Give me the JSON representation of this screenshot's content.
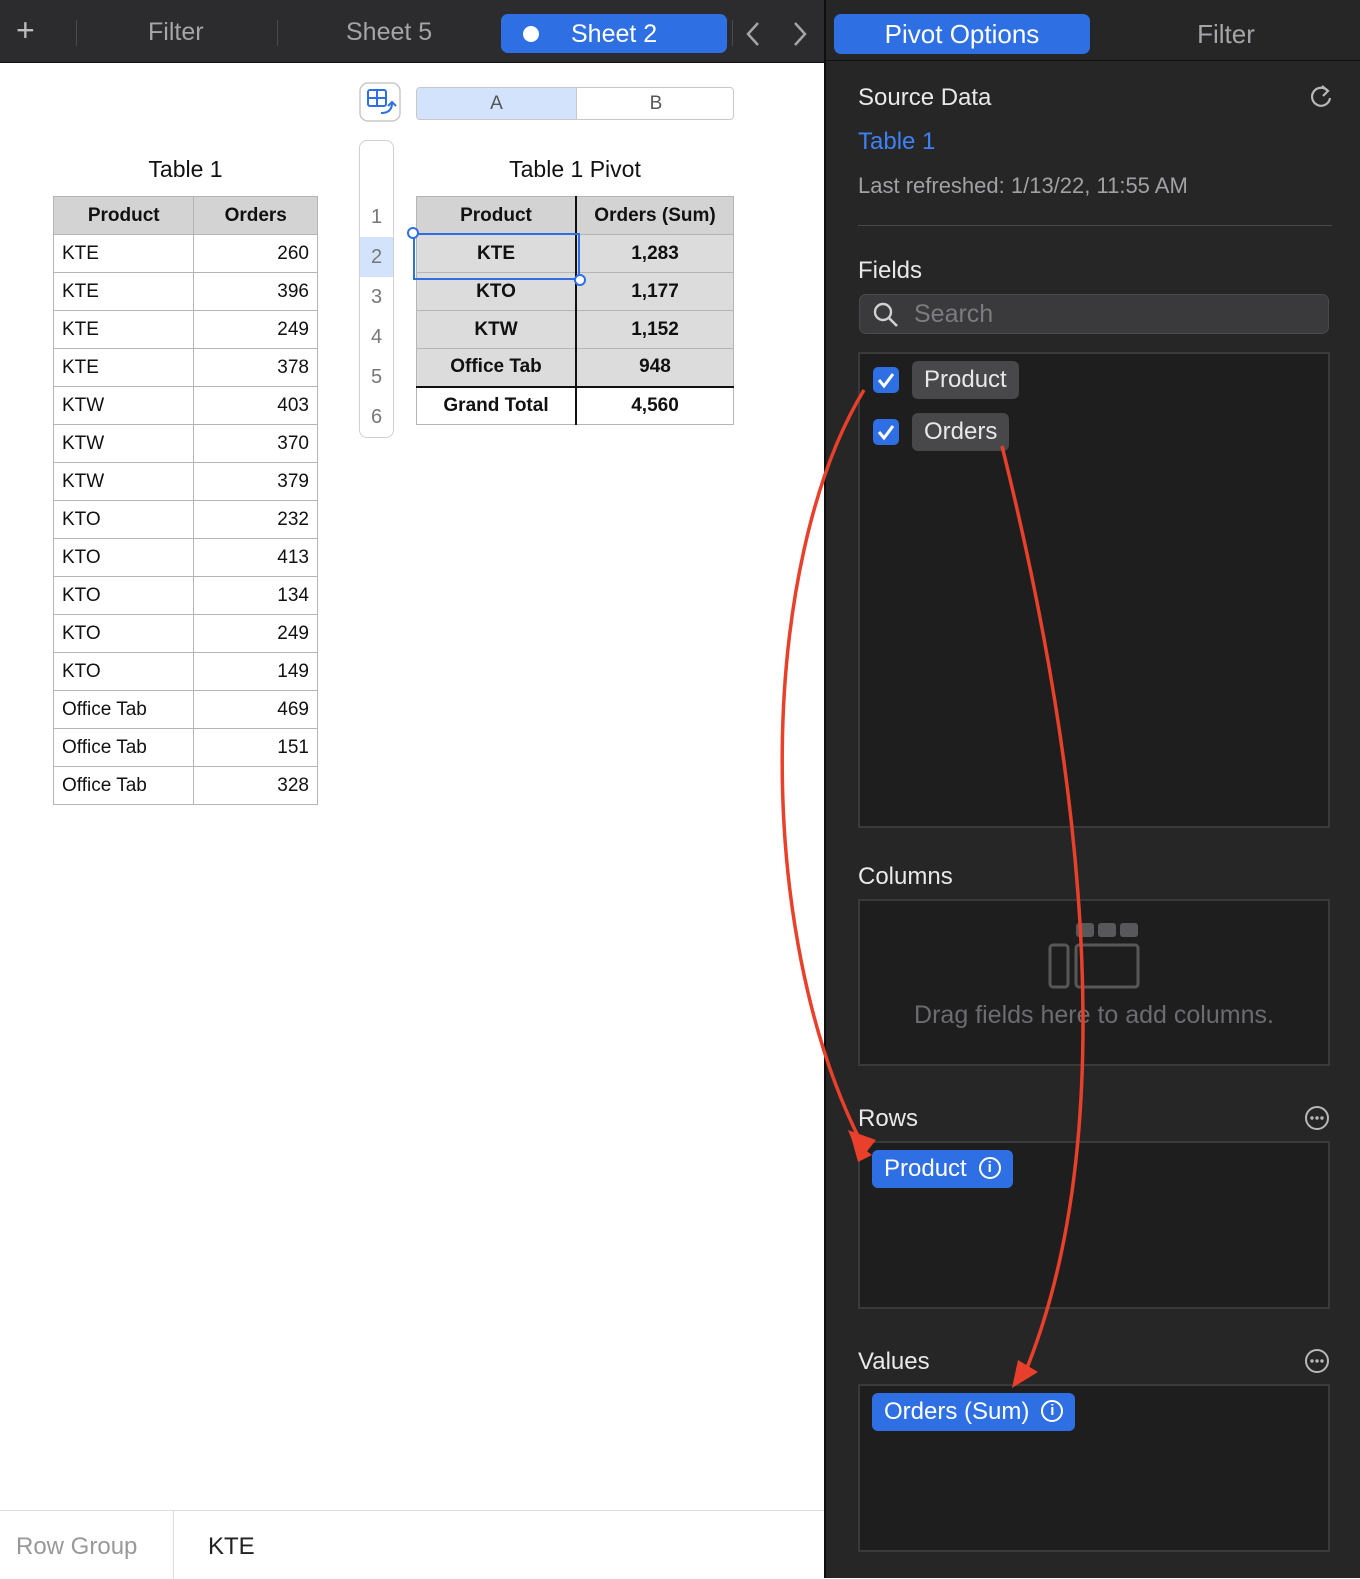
{
  "topbar": {
    "add_label": "+",
    "tabs": [
      "Filter",
      "Sheet 5",
      "Sheet 2"
    ],
    "active_tab": "Sheet 2"
  },
  "sheet": {
    "source_table": {
      "title": "Table 1",
      "headers": [
        "Product",
        "Orders"
      ],
      "rows": [
        [
          "KTE",
          "260"
        ],
        [
          "KTE",
          "396"
        ],
        [
          "KTE",
          "249"
        ],
        [
          "KTE",
          "378"
        ],
        [
          "KTW",
          "403"
        ],
        [
          "KTW",
          "370"
        ],
        [
          "KTW",
          "379"
        ],
        [
          "KTO",
          "232"
        ],
        [
          "KTO",
          "413"
        ],
        [
          "KTO",
          "134"
        ],
        [
          "KTO",
          "249"
        ],
        [
          "KTO",
          "149"
        ],
        [
          "Office Tab",
          "469"
        ],
        [
          "Office Tab",
          "151"
        ],
        [
          "Office Tab",
          "328"
        ]
      ]
    },
    "pivot_table": {
      "title": "Table 1 Pivot",
      "column_letters": [
        "A",
        "B"
      ],
      "row_numbers": [
        "1",
        "2",
        "3",
        "4",
        "5",
        "6"
      ],
      "headers": [
        "Product",
        "Orders (Sum)"
      ],
      "rows": [
        [
          "KTE",
          "1,283"
        ],
        [
          "KTO",
          "1,177"
        ],
        [
          "KTW",
          "1,152"
        ],
        [
          "Office Tab",
          "948"
        ]
      ],
      "total": [
        "Grand Total",
        "4,560"
      ]
    }
  },
  "statusbar": {
    "label": "Row Group",
    "value": "KTE"
  },
  "sidebar": {
    "tabs": [
      "Pivot Options",
      "Filter"
    ],
    "active_tab": "Pivot Options",
    "source_data": {
      "heading": "Source Data",
      "table_link": "Table 1",
      "last_refreshed": "Last refreshed: 1/13/22, 11:55 AM"
    },
    "fields": {
      "heading": "Fields",
      "search_placeholder": "Search",
      "items": [
        {
          "label": "Product",
          "checked": true
        },
        {
          "label": "Orders",
          "checked": true
        }
      ]
    },
    "columns": {
      "heading": "Columns",
      "empty_text": "Drag fields here to add columns."
    },
    "rows": {
      "heading": "Rows",
      "chips": [
        "Product"
      ]
    },
    "values": {
      "heading": "Values",
      "chips": [
        "Orders (Sum)"
      ]
    }
  },
  "colors": {
    "accent": "#2f6fe4",
    "annotation_arrow": "#e8402a",
    "sidebar_bg": "#262627"
  }
}
